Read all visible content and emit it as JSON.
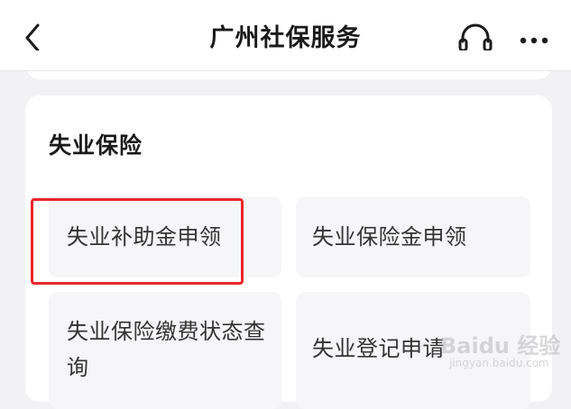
{
  "header": {
    "title": "广州社保服务",
    "back_icon": "chevron-left-icon",
    "service_icon": "headset-icon",
    "more_icon": "more-horizontal-icon"
  },
  "section": {
    "title": "失业保险",
    "items": [
      {
        "label": "失业补助金申领",
        "highlighted": true
      },
      {
        "label": "失业保险金申领",
        "highlighted": false
      },
      {
        "label": "失业保险缴费状态查询",
        "highlighted": false
      },
      {
        "label": "失业登记申请",
        "highlighted": false
      }
    ]
  },
  "colors": {
    "highlight": "#e8262a",
    "tile_bg": "#f6f6f8",
    "page_bg": "#f2f2f4"
  },
  "watermark": {
    "main": "Baidu 经验",
    "sub": "jingyan.baidu.com"
  }
}
